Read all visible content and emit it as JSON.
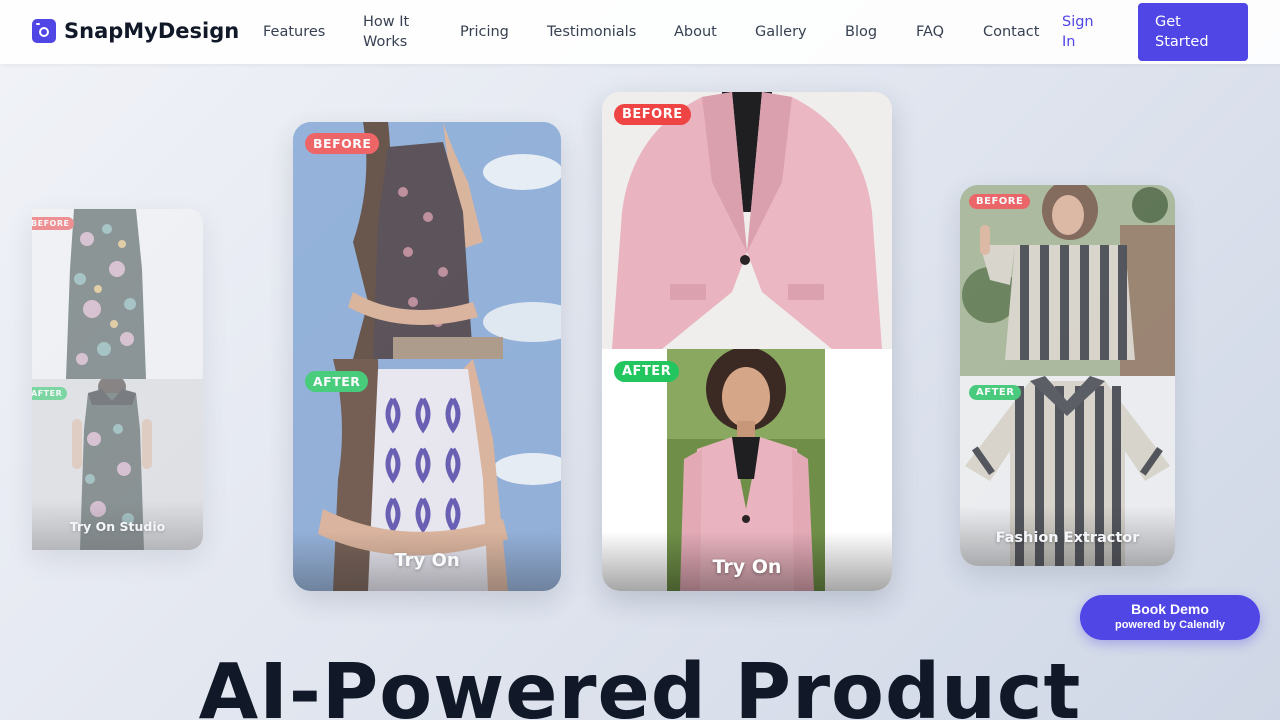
{
  "brand": {
    "name": "SnapMyDesign",
    "accent": "#4f46e5"
  },
  "nav": {
    "links": [
      {
        "label1": "Features",
        "label2": ""
      },
      {
        "label1": "How It",
        "label2": "Works"
      },
      {
        "label1": "Pricing",
        "label2": ""
      },
      {
        "label1": "Testimonials",
        "label2": ""
      },
      {
        "label1": "About",
        "label2": ""
      },
      {
        "label1": "Gallery",
        "label2": ""
      },
      {
        "label1": "Blog",
        "label2": ""
      },
      {
        "label1": "FAQ",
        "label2": ""
      },
      {
        "label1": "Contact",
        "label2": ""
      }
    ],
    "signin": {
      "label1": "Sign",
      "label2": "In"
    },
    "cta": {
      "label1": "Get",
      "label2": "Started"
    }
  },
  "cards": [
    {
      "before_badge": "BEFORE",
      "after_badge": "AFTER",
      "title": "Try On Studio"
    },
    {
      "before_badge": "BEFORE",
      "after_badge": "AFTER",
      "title": "Try On"
    },
    {
      "before_badge": "BEFORE",
      "after_badge": "AFTER",
      "title": "Try On"
    },
    {
      "before_badge": "BEFORE",
      "after_badge": "AFTER",
      "title": "Fashion Extractor"
    }
  ],
  "book_demo": {
    "title": "Book Demo",
    "subtitle": "powered by Calendly"
  },
  "hero": {
    "title": "AI-Powered Product"
  },
  "colors": {
    "before": "#ef4444",
    "after": "#22c55e"
  }
}
